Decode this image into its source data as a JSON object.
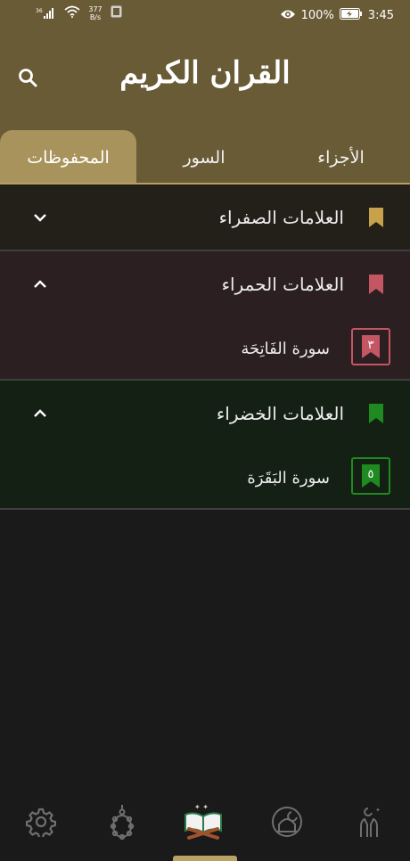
{
  "status_bar": {
    "signal_label": "36",
    "net_speed": "377",
    "net_unit": "B/s",
    "battery_percent": "100%",
    "time": "3:45"
  },
  "header": {
    "title": "القران الكريم",
    "search_icon": "search-icon"
  },
  "tabs": [
    {
      "label": "الأجزاء",
      "active": false
    },
    {
      "label": "السور",
      "active": false
    },
    {
      "label": "المحفوظات",
      "active": true
    }
  ],
  "groups": [
    {
      "title": "العلامات الصفراء",
      "color": "#c8a24a",
      "background": "#231f19",
      "expanded": false,
      "items": []
    },
    {
      "title": "العلامات الحمراء",
      "color": "#c45664",
      "background": "#2b1f22",
      "expanded": true,
      "items": [
        {
          "name": "سورة الفَاتِحَة",
          "number": "٣"
        }
      ]
    },
    {
      "title": "العلامات الخضراء",
      "color": "#1f8a1f",
      "background": "#142014",
      "expanded": true,
      "items": [
        {
          "name": "سورة البَقَرَة",
          "number": "٥"
        }
      ]
    }
  ],
  "bottom_nav": [
    {
      "icon": "settings-gear-icon",
      "active": false
    },
    {
      "icon": "prayer-beads-icon",
      "active": false
    },
    {
      "icon": "quran-book-icon",
      "active": true
    },
    {
      "icon": "mosque-dome-icon",
      "active": false
    },
    {
      "icon": "praying-hands-icon",
      "active": false
    }
  ],
  "colors": {
    "header_bg": "#6a5b37",
    "tab_active_bg": "#a8935c",
    "body_bg": "#1a1a1a",
    "accent": "#b8a266"
  }
}
